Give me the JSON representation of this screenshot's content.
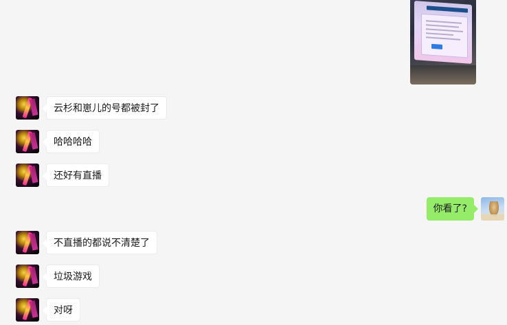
{
  "messages": [
    {
      "side": "right",
      "type": "image"
    },
    {
      "side": "left",
      "text": "云杉和崽儿的号都被封了"
    },
    {
      "side": "left",
      "text": "哈哈哈哈"
    },
    {
      "side": "left",
      "text": "还好有直播"
    },
    {
      "side": "right",
      "text": "你看了?"
    },
    {
      "side": "left",
      "text": "不直播的都说不清楚了"
    },
    {
      "side": "left",
      "text": "垃圾游戏"
    },
    {
      "side": "left",
      "text": "对呀"
    }
  ],
  "colors": {
    "background": "#f5f5f5",
    "incoming_bubble": "#ffffff",
    "outgoing_bubble": "#95ec69"
  }
}
